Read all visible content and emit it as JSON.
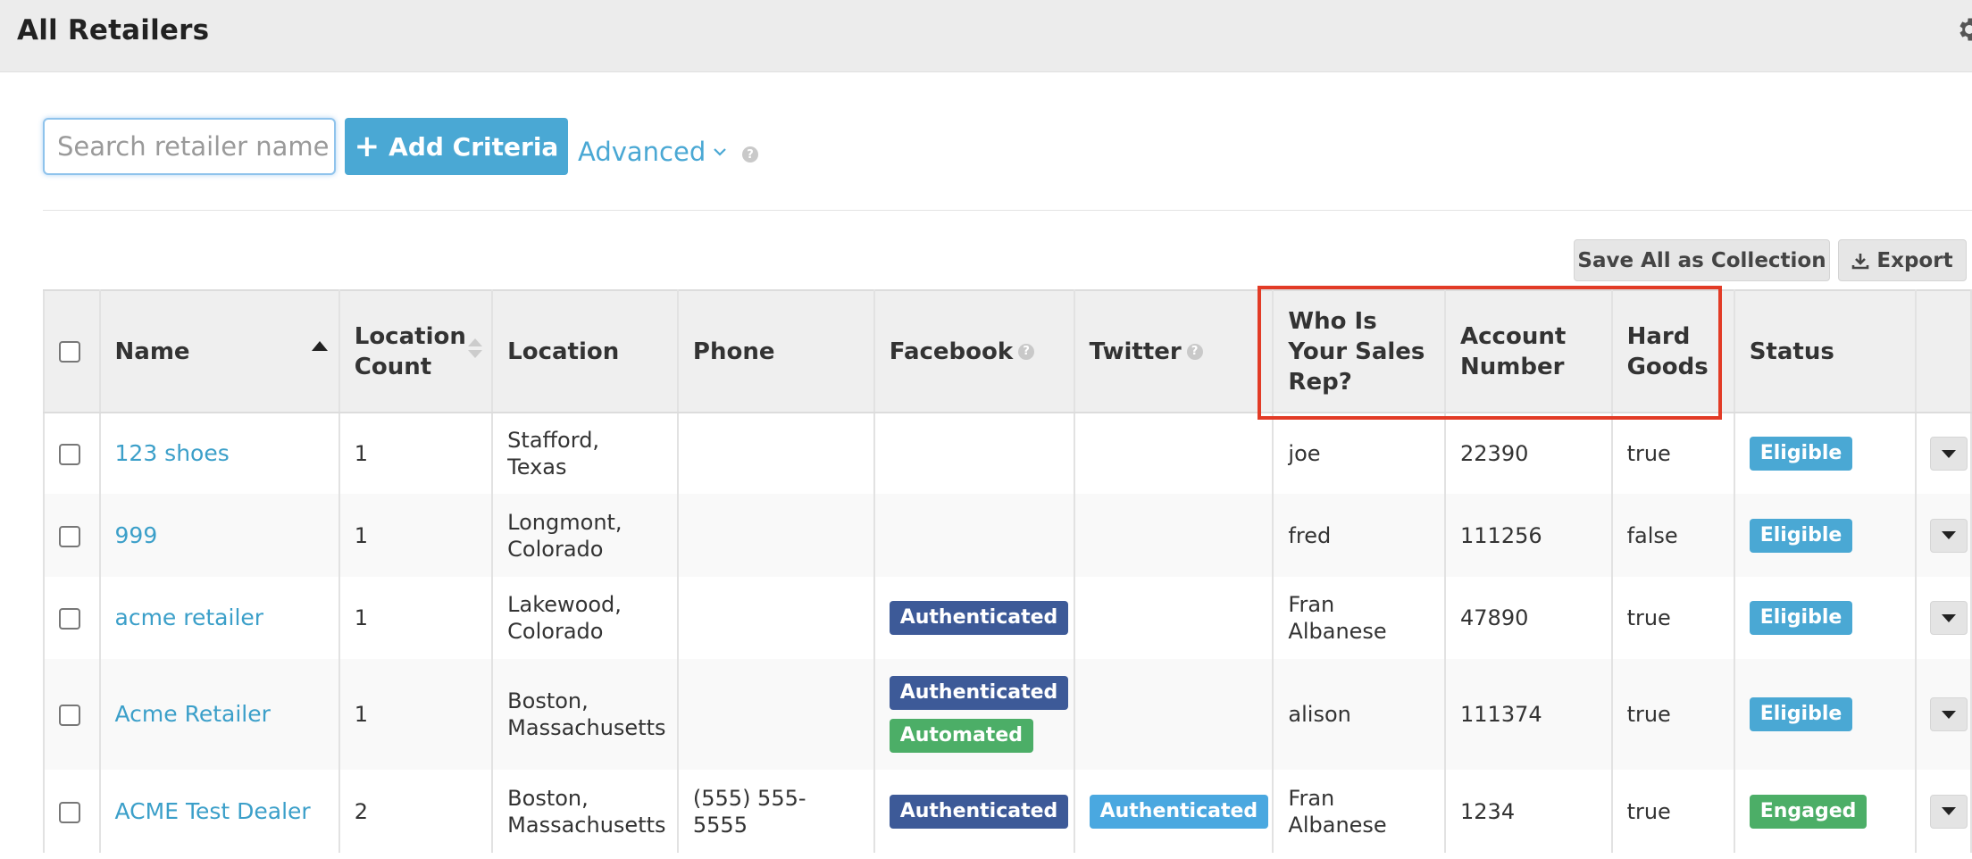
{
  "header": {
    "title": "All Retailers"
  },
  "search": {
    "placeholder": "Search retailer name",
    "add_label": "Add Criteria",
    "advanced_label": "Advanced"
  },
  "toolbar": {
    "save_label": "Save All as Collection",
    "export_label": "Export"
  },
  "table": {
    "columns": [
      "Name",
      "Location Count",
      "Location",
      "Phone",
      "Facebook",
      "Twitter",
      "Who Is Your Sales Rep?",
      "Account Number",
      "Hard Goods",
      "Status"
    ],
    "rows": [
      {
        "name": "123 shoes",
        "count": "1",
        "location": [
          "Stafford,",
          "Texas"
        ],
        "phone": "",
        "facebook": [],
        "twitter": "",
        "rep": "joe",
        "account": "22390",
        "hard_goods": "true",
        "status": "Eligible"
      },
      {
        "name": "999",
        "count": "1",
        "location": [
          "Longmont,",
          "Colorado"
        ],
        "phone": "",
        "facebook": [],
        "twitter": "",
        "rep": "fred",
        "account": "111256",
        "hard_goods": "false",
        "status": "Eligible"
      },
      {
        "name": "acme retailer",
        "count": "1",
        "location": [
          "Lakewood,",
          "Colorado"
        ],
        "phone": "",
        "facebook": [
          "Authenticated"
        ],
        "twitter": "",
        "rep": "Fran Albanese",
        "account": "47890",
        "hard_goods": "true",
        "status": "Eligible"
      },
      {
        "name": "Acme Retailer",
        "count": "1",
        "location": [
          "Boston,",
          "Massachusetts"
        ],
        "phone": "",
        "facebook": [
          "Authenticated",
          "Automated"
        ],
        "twitter": "",
        "rep": "alison",
        "account": "111374",
        "hard_goods": "true",
        "status": "Eligible"
      },
      {
        "name": "ACME Test Dealer",
        "count": "2",
        "location": [
          "Boston,",
          "Massachusetts"
        ],
        "phone": "(555) 555-5555",
        "facebook": [
          "Authenticated"
        ],
        "twitter": "Authenticated",
        "rep": "Fran Albanese",
        "account": "1234",
        "hard_goods": "true",
        "status": "Engaged"
      }
    ]
  },
  "colors": {
    "accent": "#4aa8d4",
    "facebook_badge": "#3d5a98",
    "twitter_badge": "#4aa8e0",
    "automated_badge": "#4cae67",
    "eligible_badge": "#4aa8d4",
    "engaged_badge": "#4cae67",
    "highlight": "#e23b26"
  },
  "icons": {
    "gear": "gear-icon",
    "plus": "plus-icon",
    "chevron": "chevron-down-icon",
    "help": "question-circle-icon",
    "download": "download-icon",
    "sort": "sort-icon",
    "caret": "caret-down-icon"
  }
}
